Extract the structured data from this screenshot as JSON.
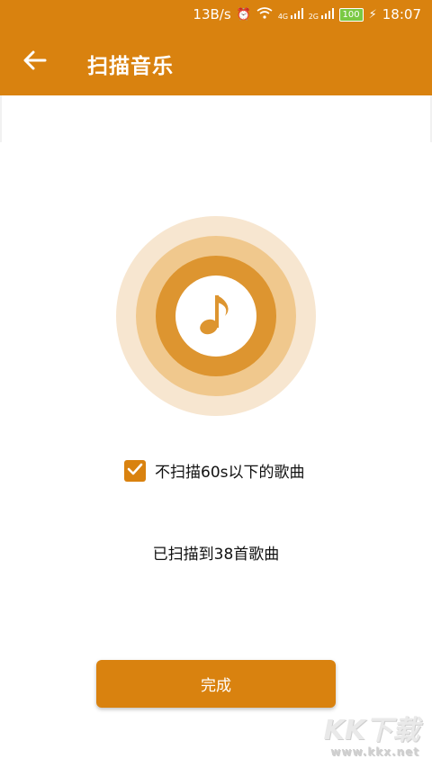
{
  "status_bar": {
    "net_speed": "13B/s",
    "time": "18:07",
    "battery": "100",
    "signal_1": "4G",
    "signal_2": "2G"
  },
  "toolbar": {
    "title": "扫描音乐"
  },
  "scan": {
    "option_label": "不扫描60s以下的歌曲",
    "option_checked": true,
    "result_text": "已扫描到38首歌曲"
  },
  "done_button": {
    "label": "完成"
  },
  "watermark": {
    "logo": "KK下载",
    "site": "www.kkx.net"
  },
  "colors": {
    "accent": "#d9820f",
    "ring_outer": "#f7e6d0",
    "ring_mid": "#f0c88d",
    "ring_inner": "#dd9530"
  },
  "icons": {
    "back": "arrow-left-icon",
    "music": "music-note-icon",
    "check": "checkmark-icon"
  }
}
